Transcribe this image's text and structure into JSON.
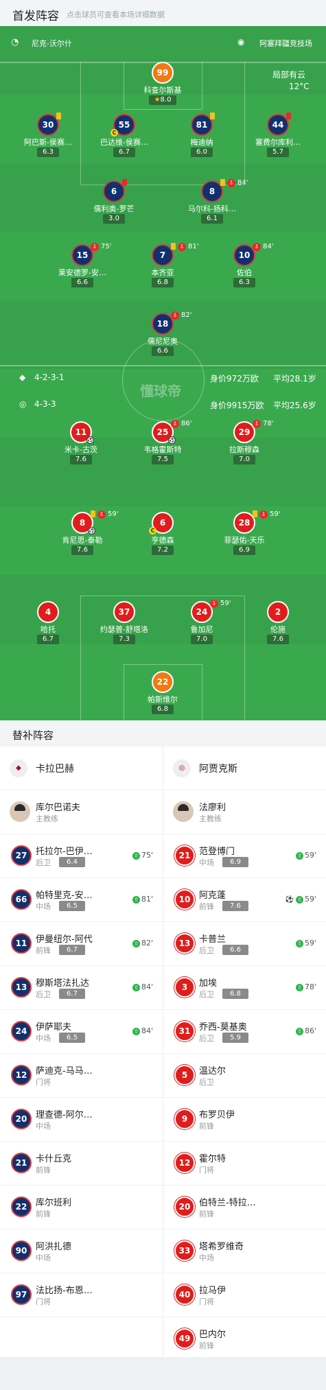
{
  "header": {
    "title": "首发阵容",
    "subtitle": "点击球员可查看本场详细数据"
  },
  "pitch": {
    "referee": "尼克-沃尔什",
    "stadium": "阿塞拜疆竞技场",
    "weather": "局部有云",
    "temperature": "12°C",
    "watermark": "懂球帝",
    "home": {
      "formation": "4-2-3-1",
      "value": "身价972万欧",
      "avg_age": "平均28.1岁"
    },
    "away": {
      "formation": "4-3-3",
      "value": "身价9915万欧",
      "avg_age": "平均25.6岁"
    },
    "players": [
      {
        "num": "99",
        "name": "科查尔斯基",
        "rating": "8.0",
        "team": "home-gk",
        "star": true
      },
      {
        "num": "30",
        "name": "阿巴斯-侯赛…",
        "rating": "6.3",
        "team": "home"
      },
      {
        "num": "55",
        "name": "巴达维-侯赛…",
        "rating": "6.7",
        "team": "home"
      },
      {
        "num": "81",
        "name": "梅迪纳",
        "rating": "6.0",
        "team": "home"
      },
      {
        "num": "44",
        "name": "塞费尔库利…",
        "rating": "5.7",
        "team": "home"
      },
      {
        "num": "6",
        "name": "儒利奥-罗芒",
        "rating": "3.0",
        "team": "home"
      },
      {
        "num": "8",
        "name": "马尔科-扬科…",
        "rating": "6.1",
        "team": "home",
        "sub": "84'"
      },
      {
        "num": "15",
        "name": "莱安德罗-安…",
        "rating": "6.6",
        "team": "home",
        "sub": "75'"
      },
      {
        "num": "7",
        "name": "本齐亚",
        "rating": "6.8",
        "team": "home",
        "sub": "81'"
      },
      {
        "num": "10",
        "name": "佐伯",
        "rating": "6.3",
        "team": "home",
        "sub": "84'"
      },
      {
        "num": "18",
        "name": "儒尼尼奥",
        "rating": "6.6",
        "team": "home",
        "sub": "82'"
      },
      {
        "num": "11",
        "name": "米卡-古茨",
        "rating": "7.6",
        "team": "away"
      },
      {
        "num": "25",
        "name": "韦格霍斯特",
        "rating": "7.5",
        "team": "away",
        "sub": "86'"
      },
      {
        "num": "29",
        "name": "拉斯穆森",
        "rating": "7.0",
        "team": "away",
        "sub": "78'"
      },
      {
        "num": "8",
        "name": "肯尼思-泰勒",
        "rating": "7.6",
        "team": "away",
        "sub": "59'"
      },
      {
        "num": "6",
        "name": "亨德森",
        "rating": "7.2",
        "team": "away"
      },
      {
        "num": "28",
        "name": "菲瑟佑-天乐",
        "rating": "6.9",
        "team": "away",
        "sub": "59'"
      },
      {
        "num": "4",
        "name": "哈托",
        "rating": "6.7",
        "team": "away"
      },
      {
        "num": "37",
        "name": "约瑟普-舒塔洛",
        "rating": "7.3",
        "team": "away"
      },
      {
        "num": "24",
        "name": "鲁加尼",
        "rating": "7.0",
        "team": "away",
        "sub": "59'"
      },
      {
        "num": "2",
        "name": "伦施",
        "rating": "7.6",
        "team": "away"
      },
      {
        "num": "22",
        "name": "帕斯维尔",
        "rating": "6.8",
        "team": "away-gk"
      }
    ]
  },
  "subs": {
    "title": "替补阵容",
    "home": {
      "team": "卡拉巴赫",
      "coach": "库尔巴诺夫",
      "coach_role": "主教练",
      "players": [
        {
          "num": "27",
          "name": "托拉尔-巴伊…",
          "pos": "后卫",
          "rating": "6.4",
          "min": "75'"
        },
        {
          "num": "66",
          "name": "帕特里克-安…",
          "pos": "中场",
          "rating": "6.5",
          "min": "81'"
        },
        {
          "num": "11",
          "name": "伊曼纽尔-阿代",
          "pos": "前锋",
          "rating": "6.7",
          "min": "82'"
        },
        {
          "num": "13",
          "name": "穆斯塔法扎达",
          "pos": "后卫",
          "rating": "6.7",
          "min": "84'"
        },
        {
          "num": "24",
          "name": "伊萨耶夫",
          "pos": "中场",
          "rating": "6.5",
          "min": "84'"
        },
        {
          "num": "12",
          "name": "萨迪克-马马…",
          "pos": "门将"
        },
        {
          "num": "20",
          "name": "理查德-阿尔…",
          "pos": "中场"
        },
        {
          "num": "21",
          "name": "卡什丘克",
          "pos": "前锋"
        },
        {
          "num": "22",
          "name": "库尔班利",
          "pos": "前锋"
        },
        {
          "num": "90",
          "name": "阿洪扎德",
          "pos": "中场"
        },
        {
          "num": "97",
          "name": "法比扬-布恩…",
          "pos": "门将"
        }
      ]
    },
    "away": {
      "team": "阿贾克斯",
      "coach": "法廖利",
      "coach_role": "主教练",
      "players": [
        {
          "num": "21",
          "name": "范登博门",
          "pos": "中场",
          "rating": "6.9",
          "min": "59'"
        },
        {
          "num": "10",
          "name": "阿克蓬",
          "pos": "前锋",
          "rating": "7.6",
          "min": "59'",
          "goal": true
        },
        {
          "num": "13",
          "name": "卡普兰",
          "pos": "后卫",
          "rating": "6.6",
          "min": "59'"
        },
        {
          "num": "3",
          "name": "加埃",
          "pos": "后卫",
          "rating": "6.8",
          "min": "78'"
        },
        {
          "num": "31",
          "name": "乔西-莫基奥",
          "pos": "后卫",
          "rating": "5.9",
          "min": "86'"
        },
        {
          "num": "5",
          "name": "温达尔",
          "pos": "后卫"
        },
        {
          "num": "9",
          "name": "布罗贝伊",
          "pos": "前锋"
        },
        {
          "num": "12",
          "name": "霍尔特",
          "pos": "门将"
        },
        {
          "num": "20",
          "name": "伯特兰-特拉…",
          "pos": "前锋"
        },
        {
          "num": "33",
          "name": "塔希罗维奇",
          "pos": "中场"
        },
        {
          "num": "40",
          "name": "拉马伊",
          "pos": "门将"
        },
        {
          "num": "49",
          "name": "巴内尔",
          "pos": "前锋"
        }
      ]
    }
  }
}
